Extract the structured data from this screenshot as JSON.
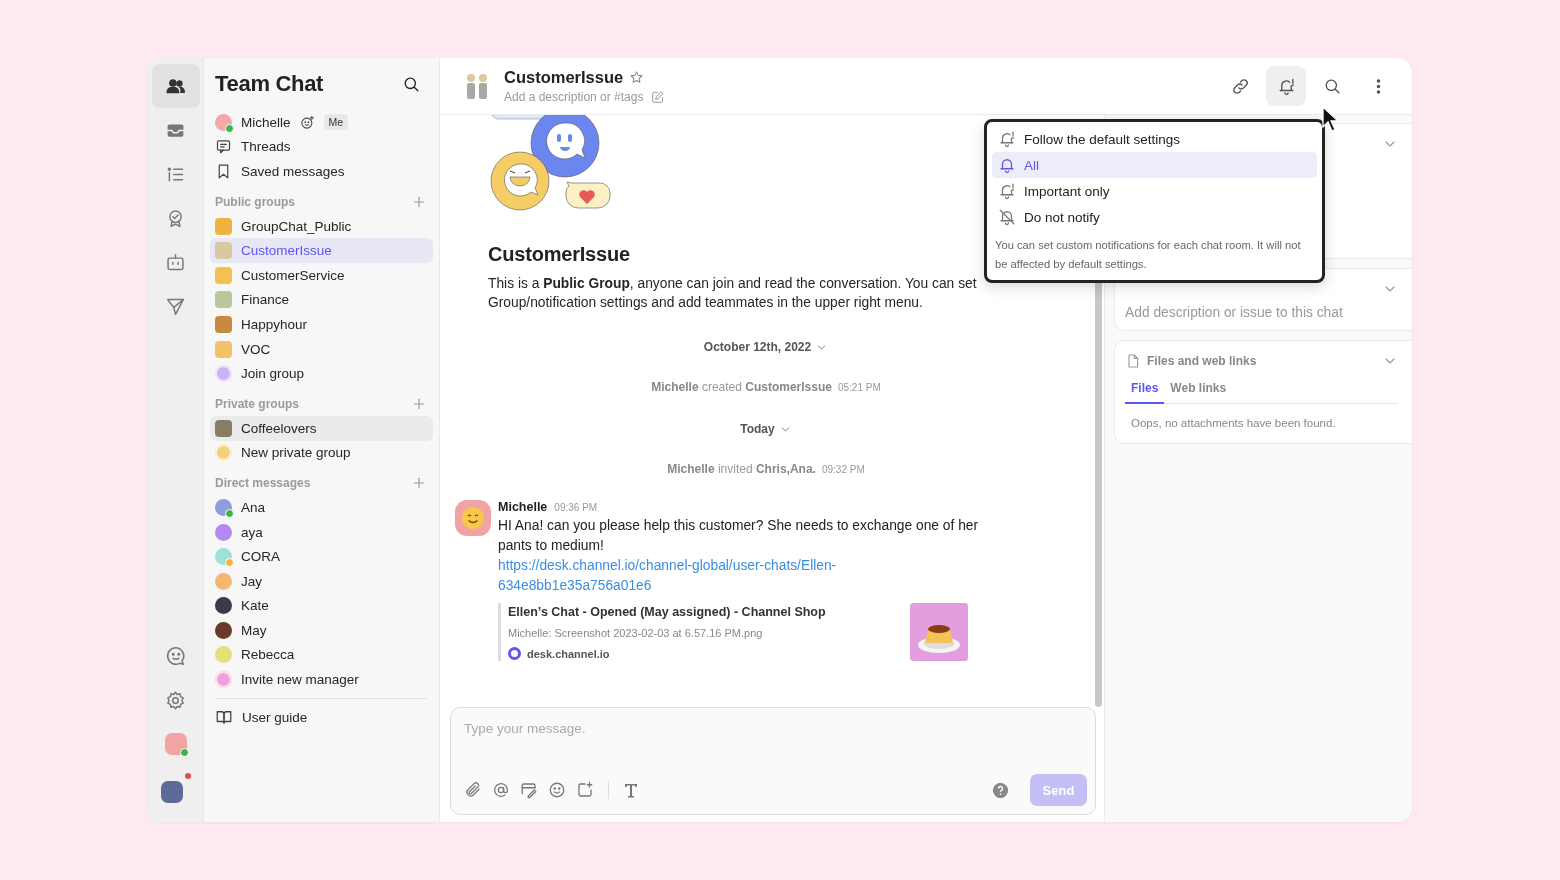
{
  "rail": {
    "top": [
      {
        "selected": true
      },
      {
        "selected": false
      },
      {
        "selected": false
      },
      {
        "selected": false
      },
      {
        "selected": false
      },
      {
        "selected": false
      }
    ],
    "user": {
      "color": "#f2a3a3",
      "online": true
    },
    "workspace": {
      "color": "#5b6a98",
      "unread": true
    }
  },
  "sidebar": {
    "title": "Team Chat",
    "me": {
      "name": "Michelle",
      "badge": "Me",
      "color": "#f4a7a7",
      "online": true
    },
    "links": [
      "Threads",
      "Saved messages"
    ],
    "sections": [
      {
        "title": "Public groups",
        "items": [
          {
            "label": "GroupChat_Public",
            "kind": "group",
            "color": "#f0b341",
            "online": false,
            "away": false,
            "selected": false,
            "hovered": false
          },
          {
            "label": "CustomerIssue",
            "kind": "group",
            "color": "#d8c9a0",
            "online": false,
            "away": false,
            "selected": true,
            "hovered": false
          },
          {
            "label": "CustomerService",
            "kind": "group",
            "color": "#f2c14e",
            "online": false,
            "away": false,
            "selected": false,
            "hovered": false
          },
          {
            "label": "Finance",
            "kind": "group",
            "color": "#b9c79a",
            "online": false,
            "away": false,
            "selected": false,
            "hovered": false
          },
          {
            "label": "Happyhour",
            "kind": "group",
            "color": "#c98a3e",
            "online": false,
            "away": false,
            "selected": false,
            "hovered": false
          },
          {
            "label": "VOC",
            "kind": "group",
            "color": "#f3c36b",
            "online": false,
            "away": false,
            "selected": false,
            "hovered": false
          },
          {
            "label": "Join group",
            "kind": "action",
            "color": "#c9b3f0",
            "online": false,
            "away": false,
            "selected": false,
            "hovered": false
          }
        ]
      },
      {
        "title": "Private groups",
        "items": [
          {
            "label": "Coffeelovers",
            "kind": "group",
            "color": "#8a7a6a",
            "online": false,
            "away": false,
            "selected": false,
            "hovered": true
          },
          {
            "label": "New private group",
            "kind": "action",
            "color": "#f5d27a",
            "online": false,
            "away": false,
            "selected": false,
            "hovered": false
          }
        ]
      },
      {
        "title": "Direct messages",
        "items": [
          {
            "label": "Ana",
            "kind": "person",
            "color": "#8d9ee0",
            "online": true,
            "away": false,
            "selected": false,
            "hovered": false
          },
          {
            "label": "aya",
            "kind": "person",
            "color": "#b58af0",
            "online": false,
            "away": false,
            "selected": false,
            "hovered": false
          },
          {
            "label": "CORA",
            "kind": "person",
            "color": "#9fe0d8",
            "online": false,
            "away": true,
            "selected": false,
            "hovered": false
          },
          {
            "label": "Jay",
            "kind": "person",
            "color": "#f5b870",
            "online": false,
            "away": false,
            "selected": false,
            "hovered": false
          },
          {
            "label": "Kate",
            "kind": "person",
            "color": "#3a3a48",
            "online": false,
            "away": false,
            "selected": false,
            "hovered": false
          },
          {
            "label": "May",
            "kind": "person",
            "color": "#6a3a2a",
            "online": false,
            "away": false,
            "selected": false,
            "hovered": false
          },
          {
            "label": "Rebecca",
            "kind": "person",
            "color": "#dfe37a",
            "online": false,
            "away": false,
            "selected": false,
            "hovered": false
          },
          {
            "label": "Invite new manager",
            "kind": "action",
            "color": "#f0a0dc",
            "online": false,
            "away": false,
            "selected": false,
            "hovered": false
          }
        ]
      }
    ],
    "guide": "User guide"
  },
  "chat": {
    "header": {
      "title": "CustomerIssue",
      "description_placeholder": "Add a description or #tags",
      "starred": false,
      "color": "#d8c9a0"
    },
    "actions": [
      {
        "kind": "link",
        "active": false
      },
      {
        "kind": "bell",
        "active": true
      },
      {
        "kind": "search",
        "active": false
      },
      {
        "kind": "more",
        "active": false
      }
    ],
    "intro": {
      "title": "CustomerIssue",
      "text": "This is a **Public Group**, anyone can join and read the conversation. You can set Group/notification settings and add teammates in the upper right menu."
    },
    "timeline": [
      {
        "kind": "date",
        "label": "October 12th, 2022"
      },
      {
        "kind": "system",
        "text": "**Michelle** created **CustomerIssue**",
        "time": "05:21 PM"
      },
      {
        "kind": "date",
        "label": "Today"
      },
      {
        "kind": "system",
        "text": "**Michelle** invited **Chris,Ana.**",
        "time": "09:32 PM"
      },
      {
        "kind": "message",
        "author": "Michelle",
        "time": "09:36 PM",
        "color": "#f2a3a3",
        "text": "HI Ana! can you please help this customer? She needs to exchange one of her pants to medium!",
        "link": "https://desk.channel.io/channel-global/user-chats/Ellen-634e8bb1e35a756a01e6",
        "preview": {
          "title": "Ellen’s Chat - Opened (May assigned) - Channel Shop",
          "subtitle": "Michelle: Screenshot 2023-02-03 at 6.57.16 PM.png",
          "site": "desk.channel.io"
        }
      }
    ],
    "composer": {
      "placeholder": "Type your message.",
      "send": "Send",
      "send_disabled": true
    }
  },
  "details": {
    "description_card": {
      "placeholder": "Add description or issue to this chat"
    },
    "files_card": {
      "title": "Files and web links",
      "tabs": [
        {
          "label": "Files",
          "selected": true
        },
        {
          "label": "Web links",
          "selected": false
        }
      ],
      "empty": "Oops, no attachments have been found."
    }
  },
  "notification_menu": {
    "options": [
      {
        "label": "Follow the default settings",
        "kind": "default",
        "selected": false
      },
      {
        "label": "All",
        "kind": "all",
        "selected": true
      },
      {
        "label": "Important only",
        "kind": "important",
        "selected": false
      },
      {
        "label": "Do not notify",
        "kind": "off",
        "selected": false
      }
    ],
    "note": "You can set custom notifications for each chat room. It will not be affected by default settings."
  }
}
